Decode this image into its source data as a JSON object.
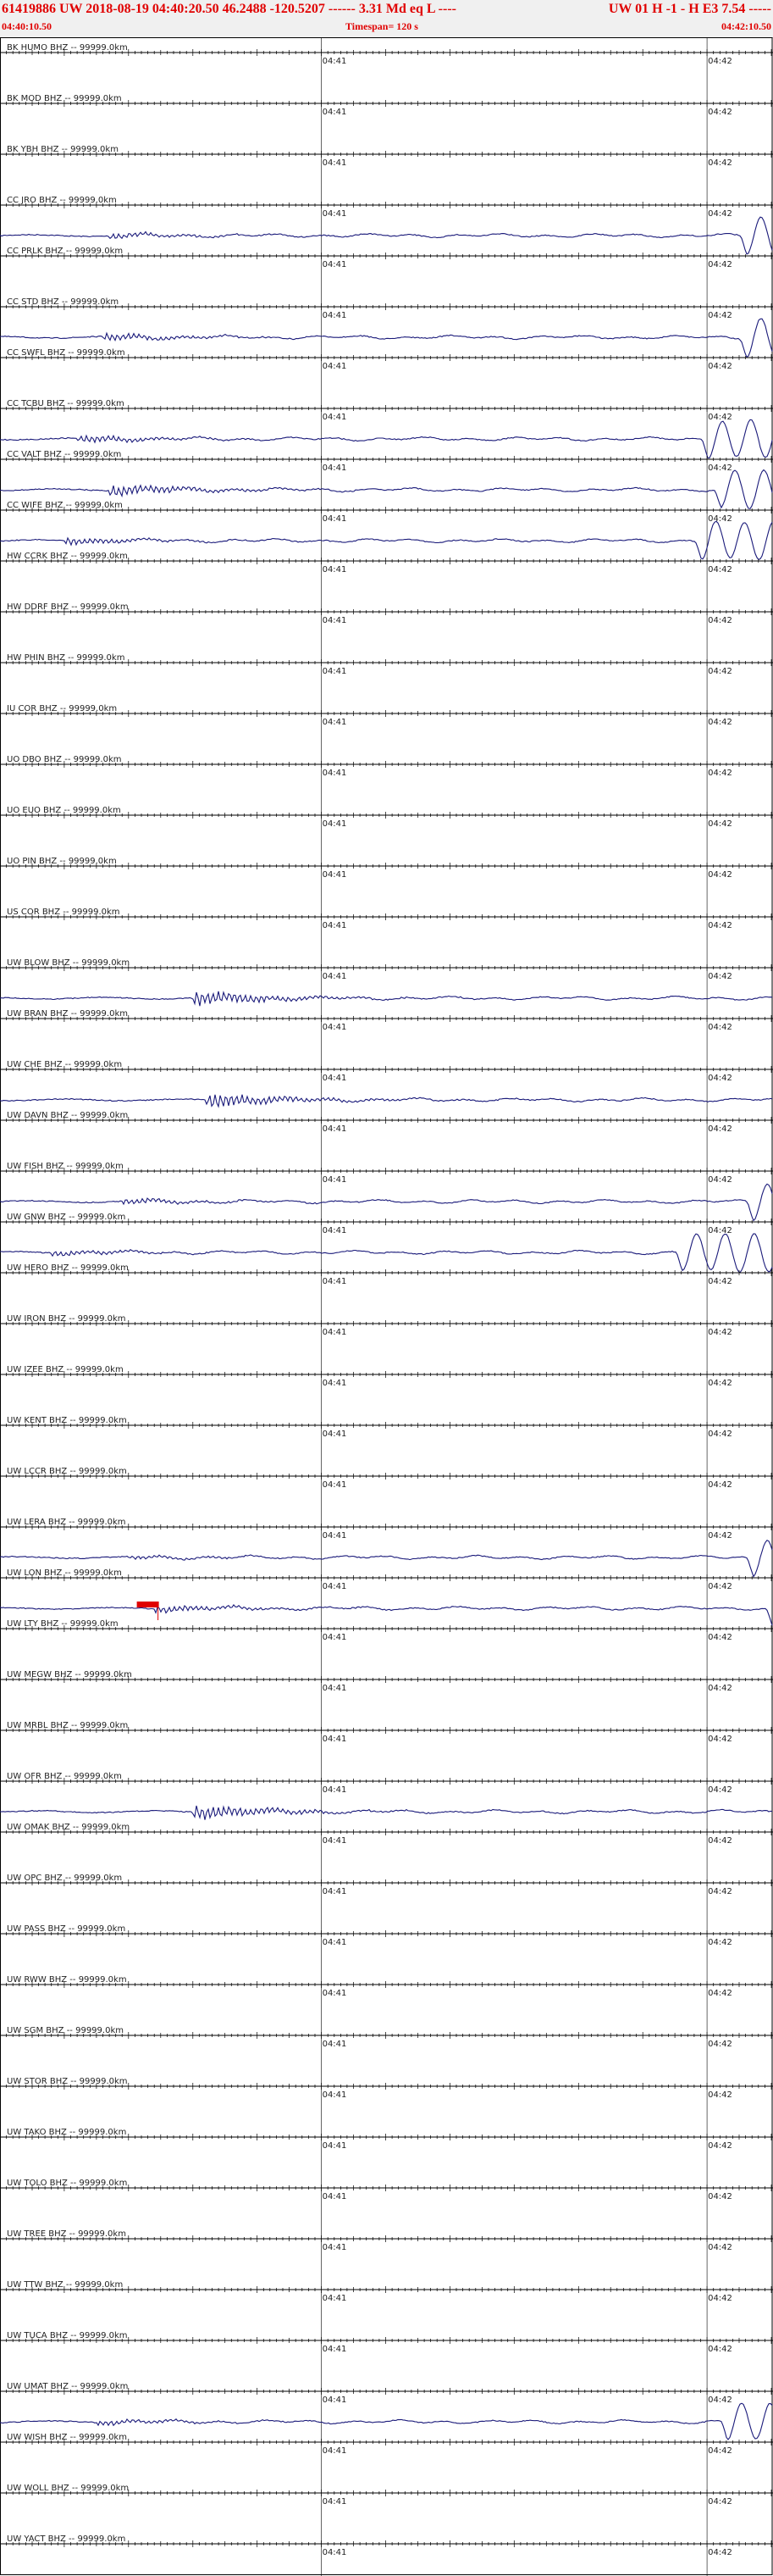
{
  "header": {
    "main": "61419886 UW 2018-08-19 04:40:20.50   46.2488 -120.5207 ------  3.31 Md  eq  L ----",
    "right": "UW 01  H  -1  -  H E3    7.54 -----",
    "start_time": "04:40:10.50",
    "timespan": "Timespan= 120 s",
    "end_time": "04:42:10.50"
  },
  "colors": {
    "title": "#e00000",
    "trace": "#1a1a7a",
    "pick": "#e00000",
    "grid": "#000000"
  },
  "chart_data": {
    "type": "line",
    "time_span_s": 120,
    "xlim": [
      0,
      120
    ],
    "tick_labels": [
      {
        "t": 50,
        "label": "04:41"
      },
      {
        "t": 110,
        "label": "04:42"
      }
    ],
    "channels": [
      {
        "name": "BK HUMO BHZ -- 99999.0km",
        "trace": false
      },
      {
        "name": "BK MOD BHZ -- 99999.0km",
        "trace": false
      },
      {
        "name": "BK YBH BHZ -- 99999.0km",
        "trace": false
      },
      {
        "name": "CC JRO BHZ -- 99999.0km",
        "trace": true,
        "p": 17,
        "amp": 3,
        "big": 115
      },
      {
        "name": "CC PRLK BHZ -- 99999.0km",
        "trace": false
      },
      {
        "name": "CC STD BHZ -- 99999.0km",
        "trace": true,
        "p": 16,
        "amp": 4,
        "big": 115
      },
      {
        "name": "CC SWFL BHZ -- 99999.0km",
        "trace": false
      },
      {
        "name": "CC TCBU BHZ -- 99999.0km",
        "trace": true,
        "p": 12,
        "amp": 4,
        "big": 109
      },
      {
        "name": "CC VALT BHZ -- 99999.0km",
        "trace": true,
        "p": 17,
        "amp": 6,
        "big": 111
      },
      {
        "name": "CC WIFE BHZ -- 99999.0km",
        "trace": true,
        "p": 10,
        "amp": 4,
        "big": 108
      },
      {
        "name": "HW CCRK BHZ -- 99999.0km",
        "trace": false
      },
      {
        "name": "HW DDRF BHZ -- 99999.0km",
        "trace": false
      },
      {
        "name": "HW PHIN BHZ -- 99999.0km",
        "trace": false
      },
      {
        "name": "IU COR BHZ -- 99999.0km",
        "trace": false
      },
      {
        "name": "UO DBO BHZ -- 99999.0km",
        "trace": false
      },
      {
        "name": "UO EUO BHZ -- 99999.0km",
        "trace": false
      },
      {
        "name": "UO PIN BHZ -- 99999.0km",
        "trace": false
      },
      {
        "name": "US COR BHZ -- 99999.0km",
        "trace": false
      },
      {
        "name": "UW BLOW BHZ -- 99999.0km",
        "trace": true,
        "p": 30,
        "amp": 8,
        "big": null
      },
      {
        "name": "UW BRAN BHZ -- 99999.0km",
        "trace": false
      },
      {
        "name": "UW CHE BHZ -- 99999.0km",
        "trace": true,
        "p": 32,
        "amp": 8,
        "big": null
      },
      {
        "name": "UW DAVN BHZ -- 99999.0km",
        "trace": false
      },
      {
        "name": "UW FISH BHZ -- 99999.0km",
        "trace": true,
        "p": 19,
        "amp": 3,
        "big": 116
      },
      {
        "name": "UW GNW BHZ -- 99999.0km",
        "trace": true,
        "p": 8,
        "amp": 3,
        "big": 105
      },
      {
        "name": "UW HERO BHZ -- 99999.0km",
        "trace": false
      },
      {
        "name": "UW IRON BHZ -- 99999.0km",
        "trace": false
      },
      {
        "name": "UW IZEE BHZ -- 99999.0km",
        "trace": false
      },
      {
        "name": "UW KENT BHZ -- 99999.0km",
        "trace": false
      },
      {
        "name": "UW LCCR BHZ -- 99999.0km",
        "trace": false
      },
      {
        "name": "UW LERA BHZ -- 99999.0km",
        "trace": true,
        "p": 20,
        "amp": 2,
        "big": 116
      },
      {
        "name": "UW LON BHZ -- 99999.0km",
        "trace": true,
        "p": 24,
        "amp": 4,
        "big": 119,
        "pick": 23
      },
      {
        "name": "UW LTY BHZ -- 99999.0km",
        "trace": false
      },
      {
        "name": "UW MEGW BHZ -- 99999.0km",
        "trace": false
      },
      {
        "name": "UW MRBL BHZ -- 99999.0km",
        "trace": false
      },
      {
        "name": "UW OFR BHZ -- 99999.0km",
        "trace": true,
        "p": 30,
        "amp": 8,
        "big": null
      },
      {
        "name": "UW OMAK BHZ -- 99999.0km",
        "trace": false
      },
      {
        "name": "UW OPC BHZ -- 99999.0km",
        "trace": false
      },
      {
        "name": "UW PASS BHZ -- 99999.0km",
        "trace": false
      },
      {
        "name": "UW RWW BHZ -- 99999.0km",
        "trace": false
      },
      {
        "name": "UW SGM BHZ -- 99999.0km",
        "trace": false
      },
      {
        "name": "UW STOR BHZ -- 99999.0km",
        "trace": false
      },
      {
        "name": "UW TAKO BHZ -- 99999.0km",
        "trace": false
      },
      {
        "name": "UW TOLO BHZ -- 99999.0km",
        "trace": false
      },
      {
        "name": "UW TREE BHZ -- 99999.0km",
        "trace": false
      },
      {
        "name": "UW TTW BHZ -- 99999.0km",
        "trace": false
      },
      {
        "name": "UW TUCA BHZ -- 99999.0km",
        "trace": false
      },
      {
        "name": "UW UMAT BHZ -- 99999.0km",
        "trace": true,
        "p": 15,
        "amp": 3,
        "big": 112
      },
      {
        "name": "UW WISH BHZ -- 99999.0km",
        "trace": false
      },
      {
        "name": "UW WOLL BHZ -- 99999.0km",
        "trace": false
      },
      {
        "name": "UW YACT BHZ -- 99999.0km",
        "trace": false
      }
    ]
  }
}
